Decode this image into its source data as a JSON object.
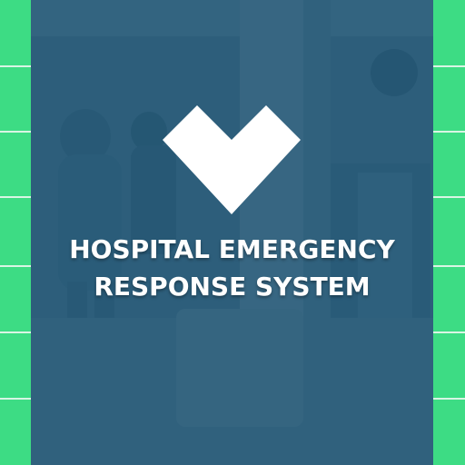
{
  "brand": {
    "logo_icon": "heart-chevron-icon",
    "title_line1": "HOSPITAL EMERGENCY",
    "title_line2": "RESPONSE SYSTEM"
  },
  "colors": {
    "accent": "#3ddc84",
    "stripe": "#d9f5e4",
    "panel": "#2a5a76",
    "text": "#ffffff"
  },
  "background": {
    "description_icon": "hospital-corridor-photo"
  }
}
